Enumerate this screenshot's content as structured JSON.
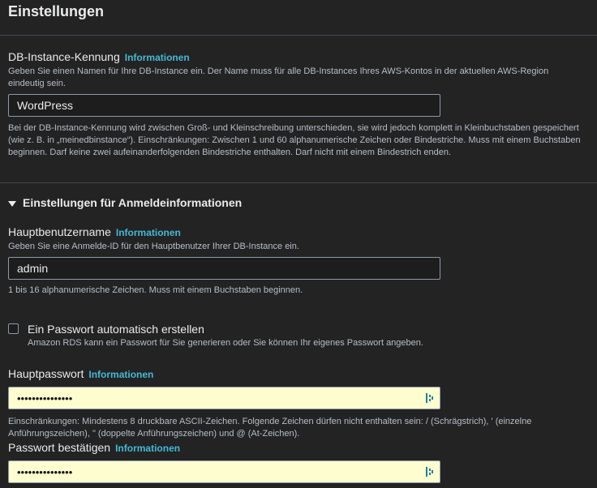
{
  "header": {
    "title": "Einstellungen"
  },
  "db_instance": {
    "label": "DB-Instance-Kennung",
    "info": "Informationen",
    "description": "Geben Sie einen Namen für Ihre DB-Instance ein. Der Name muss für alle DB-Instances Ihres AWS-Kontos in der aktuellen AWS-Region eindeutig sein.",
    "value": "WordPress",
    "constraints": "Bei der DB-Instance-Kennung wird zwischen Groß- und Kleinschreibung unterschieden, sie wird jedoch komplett in Kleinbuchstaben gespeichert (wie z. B. in „meinedbinstance“). Einschränkungen: Zwischen 1 und 60 alphanumerische Zeichen oder Bindestriche. Muss mit einem Buchstaben beginnen. Darf keine zwei aufeinanderfolgenden Bindestriche enthalten. Darf nicht mit einem Bindestrich enden."
  },
  "credentials": {
    "section_title": "Einstellungen für Anmeldeinformationen",
    "master_user": {
      "label": "Hauptbenutzername",
      "info": "Informationen",
      "description": "Geben Sie eine Anmelde-ID für den Hauptbenutzer Ihrer DB-Instance ein.",
      "value": "admin",
      "constraints": "1 bis 16 alphanumerische Zeichen. Muss mit einem Buchstaben beginnen."
    },
    "auto_password": {
      "label": "Ein Passwort automatisch erstellen",
      "description": "Amazon RDS kann ein Passwort für Sie generieren oder Sie können Ihr eigenes Passwort angeben.",
      "checked": false
    },
    "master_password": {
      "label": "Hauptpasswort",
      "info": "Informationen",
      "value": "•••••••••••••••",
      "constraints": "Einschränkungen: Mindestens 8 druckbare ASCII-Zeichen. Folgende Zeichen dürfen nicht enthalten sein: / (Schrägstrich), ' (einzelne Anführungszeichen), \" (doppelte Anführungszeichen) und @ (At-Zeichen)."
    },
    "confirm_password": {
      "label": "Passwort bestätigen",
      "info": "Informationen",
      "value": "•••••••••••••••"
    }
  }
}
